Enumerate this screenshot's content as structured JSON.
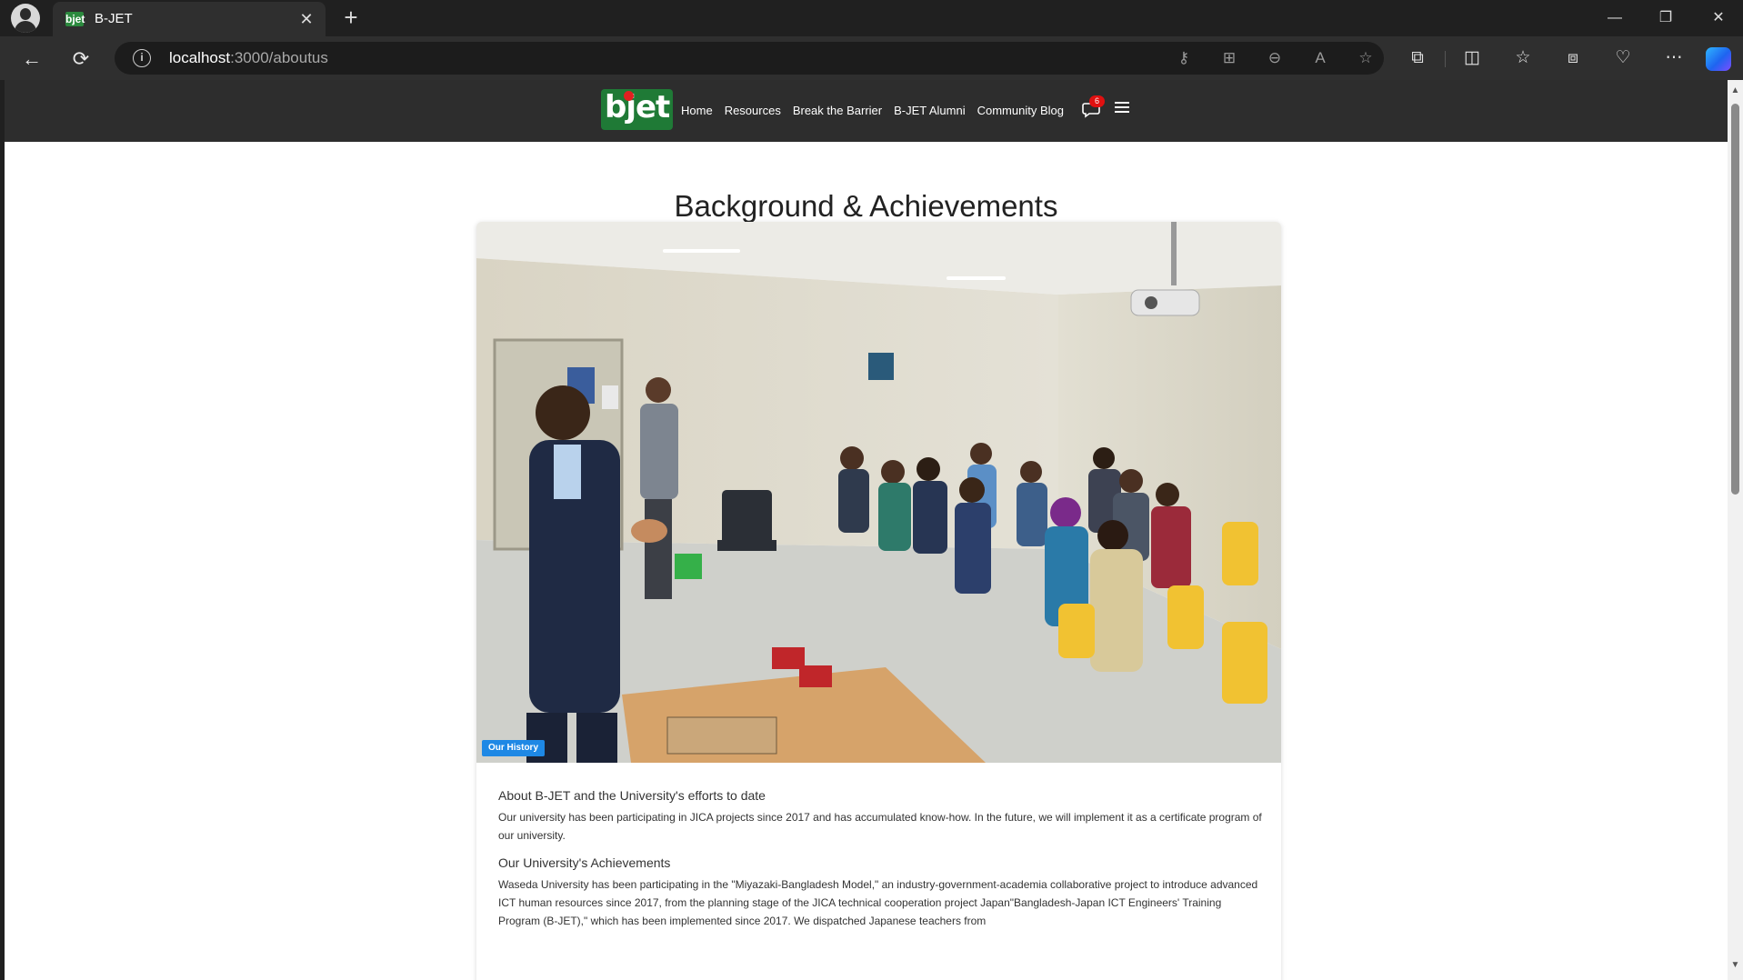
{
  "browser": {
    "tab_title": "B-JET",
    "tab_favicon": "bjet",
    "url_host": "localhost",
    "url_path": ":3000/aboutus"
  },
  "site": {
    "logo_text": "bjet",
    "nav": [
      "Home",
      "Resources",
      "Break the Barrier",
      "B-JET Alumni",
      "Community Blog"
    ],
    "message_count": "6",
    "colors": {
      "nav_bg": "#2d2d2d",
      "logo_green": "#1f7a36",
      "badge_red": "#e01010",
      "history_blue": "#1e88e5"
    }
  },
  "page": {
    "title": "Background & Achievements",
    "photo_badge": "Our History",
    "sections": [
      {
        "title": "About B-JET and the University's efforts to date",
        "text": "Our university has been participating in JICA projects since 2017 and has accumulated know-how. In the future, we will implement it as a certificate program of our university."
      },
      {
        "title": "Our University's Achievements",
        "text": "Waseda University has been participating in the \"Miyazaki-Bangladesh Model,\" an industry-government-academia collaborative project to introduce advanced ICT human resources since 2017, from the planning stage of the JICA technical cooperation project Japan\"Bangladesh-Japan ICT Engineers' Training Program (B-JET),\" which has been implemented since 2017. We dispatched Japanese teachers from"
      }
    ]
  }
}
